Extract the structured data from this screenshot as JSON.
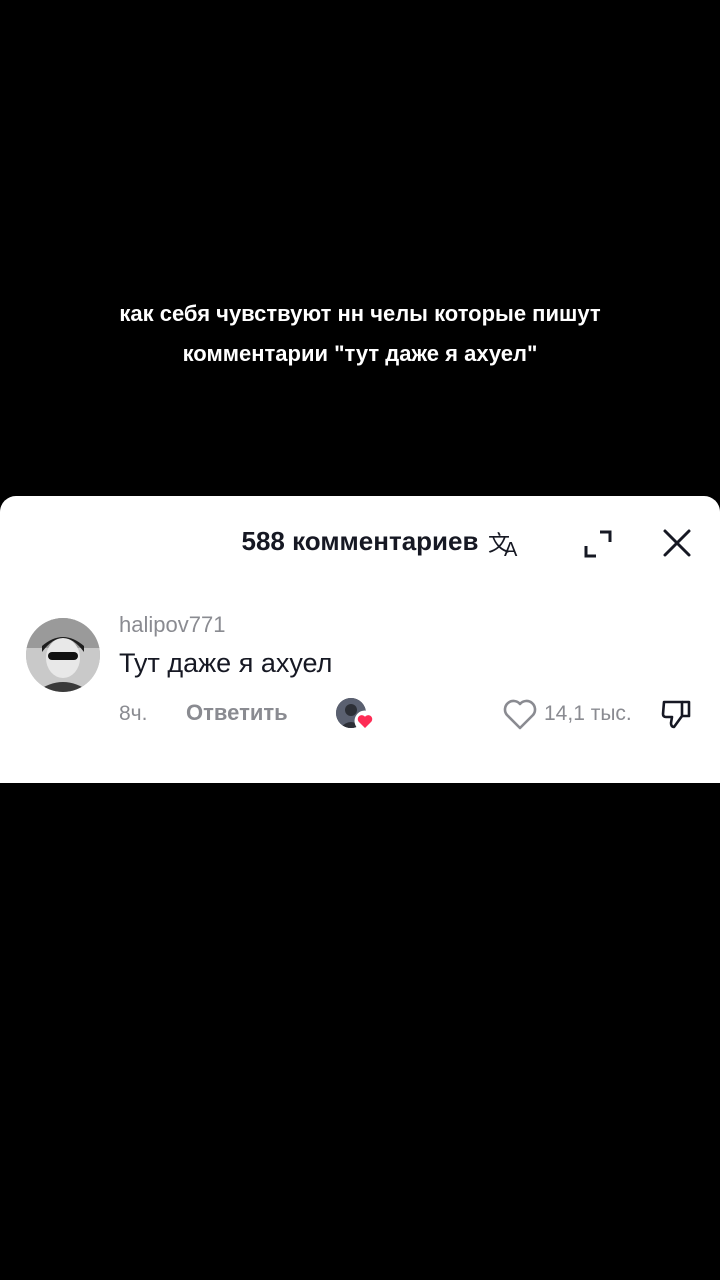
{
  "caption": {
    "line1": "как себя чувствуют нн челы которые пишут",
    "line2": "комментарии \"тут даже я ахуел\""
  },
  "comments_panel": {
    "title": "588 комментариев",
    "icons": {
      "translate": "translate-icon",
      "expand": "expand-icon",
      "close": "close-icon"
    }
  },
  "comment": {
    "username": "halipov771",
    "text": "Тут даже я ахуел",
    "time": "8ч.",
    "reply_label": "Ответить",
    "likes": "14,1 тыс.",
    "icons": {
      "like": "heart-outline-icon",
      "dislike": "thumbs-down-icon",
      "creator_liked": "creator-liked-heart-icon"
    }
  },
  "colors": {
    "background": "#000000",
    "sheet": "#ffffff",
    "primary_text": "#161823",
    "secondary_text": "#8a8b91",
    "heart_accent": "#fe2c55"
  }
}
